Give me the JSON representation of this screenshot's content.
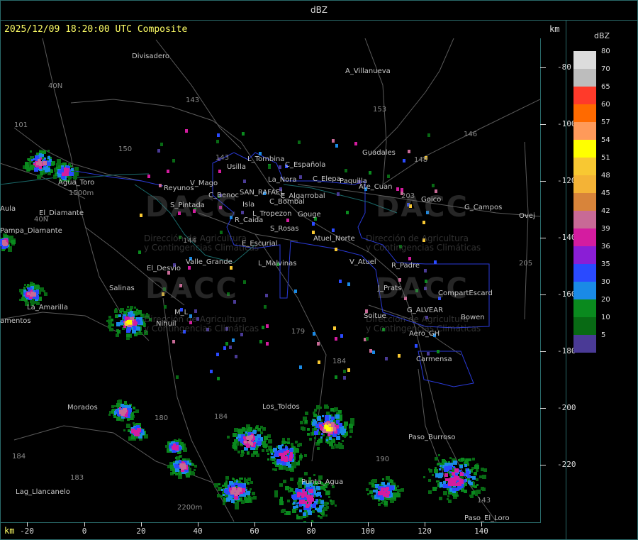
{
  "window_title": "dBZ",
  "header": {
    "datetime": "2025/12/09 18:20:00 UTC Composite",
    "km_top": "km",
    "km_bottom": "km"
  },
  "legend": {
    "title": "dBZ",
    "items": [
      {
        "label": "80",
        "color": "#dcdcdc"
      },
      {
        "label": "70",
        "color": "#bdbdbd"
      },
      {
        "label": "65",
        "color": "#ff3a2a"
      },
      {
        "label": "60",
        "color": "#ff6a00"
      },
      {
        "label": "57",
        "color": "#ff9a5a"
      },
      {
        "label": "54",
        "color": "#ffff00"
      },
      {
        "label": "51",
        "color": "#f8c832"
      },
      {
        "label": "48",
        "color": "#f4b336"
      },
      {
        "label": "45",
        "color": "#d8843a"
      },
      {
        "label": "42",
        "color": "#c86a96"
      },
      {
        "label": "39",
        "color": "#d41ca0"
      },
      {
        "label": "36",
        "color": "#8a1ed6"
      },
      {
        "label": "35",
        "color": "#2a4aff"
      },
      {
        "label": "30",
        "color": "#1a8ae6"
      },
      {
        "label": "20",
        "color": "#0a8a1e"
      },
      {
        "label": "10",
        "color": "#086a14"
      },
      {
        "label": "5",
        "color": "#4a3a96"
      }
    ]
  },
  "axes": {
    "y_ticks": [
      "-80",
      "-100",
      "-120",
      "-140",
      "-160",
      "-180",
      "-200",
      "-220"
    ],
    "x_ticks": [
      "-20",
      "0",
      "20",
      "40",
      "60",
      "80",
      "100",
      "120",
      "140"
    ]
  },
  "watermark": {
    "logo": "DACC",
    "line1": "Dirección de Agricultura",
    "line2": "y Contingencias Climáticas"
  },
  "places": [
    {
      "id": "divisadero",
      "text": "Divisadero"
    },
    {
      "id": "a-villanueva",
      "text": "A_Villanueva"
    },
    {
      "id": "guadales",
      "text": "Guadales"
    },
    {
      "id": "l-tombina",
      "text": "L_Tombina"
    },
    {
      "id": "usilla",
      "text": "Usilla"
    },
    {
      "id": "c-espanola",
      "text": "C_Española"
    },
    {
      "id": "la-nora",
      "text": "La_Nora"
    },
    {
      "id": "c-elepa",
      "text": "C_Elepa"
    },
    {
      "id": "paquilla",
      "text": "Paquilla"
    },
    {
      "id": "ate-cuan",
      "text": "Ate_Cuan"
    },
    {
      "id": "agua-toro",
      "text": "Agua_Toro"
    },
    {
      "id": "reyunos",
      "text": "Reyunos"
    },
    {
      "id": "v-mago",
      "text": "V_Mago"
    },
    {
      "id": "c-benoc",
      "text": "C_Benoc"
    },
    {
      "id": "san-rafael",
      "text": "SAN_RAFAEL"
    },
    {
      "id": "e-algarrobal",
      "text": "E_Algarrobal"
    },
    {
      "id": "c-bombal",
      "text": "C_Bombal"
    },
    {
      "id": "goico",
      "text": "Goico"
    },
    {
      "id": "g-campos",
      "text": "G_Campos"
    },
    {
      "id": "vuela",
      "text": "Aula"
    },
    {
      "id": "s-pintada",
      "text": "S_Pintada"
    },
    {
      "id": "isla",
      "text": "Isla"
    },
    {
      "id": "l-tropezon",
      "text": "L_Tropezon"
    },
    {
      "id": "gouge",
      "text": "Gouge"
    },
    {
      "id": "el-diamante",
      "text": "El_Diamante"
    },
    {
      "id": "r-caida",
      "text": "R_Caida"
    },
    {
      "id": "s-rosas",
      "text": "S_Rosas"
    },
    {
      "id": "ovejero",
      "text": "Ovej"
    },
    {
      "id": "pampa-diamante",
      "text": "Pampa_Diamante"
    },
    {
      "id": "e-escurial",
      "text": "E_Escurial"
    },
    {
      "id": "atuel-norte",
      "text": "Atuel_Norte"
    },
    {
      "id": "valle-grande",
      "text": "Valle_Grande"
    },
    {
      "id": "l-malvinas",
      "text": "L_Malvinas"
    },
    {
      "id": "v-atuel",
      "text": "V_Atuel"
    },
    {
      "id": "r-padre",
      "text": "R_Padre"
    },
    {
      "id": "el-desvio",
      "text": "El_Desvio"
    },
    {
      "id": "salinas",
      "text": "Salinas"
    },
    {
      "id": "j-prats",
      "text": "J_Prats"
    },
    {
      "id": "compart-escard",
      "text": "CompartEscard"
    },
    {
      "id": "la-amarilla",
      "text": "La_Amarilla"
    },
    {
      "id": "g-alvear",
      "text": "G_ALVEAR"
    },
    {
      "id": "m-l",
      "text": "M_L"
    },
    {
      "id": "soitue",
      "text": "Soitue"
    },
    {
      "id": "bowen",
      "text": "Bowen"
    },
    {
      "id": "sacramentos",
      "text": "amentos"
    },
    {
      "id": "nihuil",
      "text": "Nihuil"
    },
    {
      "id": "aero-gh",
      "text": "Aero_GH"
    },
    {
      "id": "carmensa",
      "text": "Carmensa"
    },
    {
      "id": "morados",
      "text": "Morados"
    },
    {
      "id": "los-toldos",
      "text": "Los_Toldos"
    },
    {
      "id": "paso-burroso",
      "text": "Paso_Burroso"
    },
    {
      "id": "punta-agua",
      "text": "Punta_Agua"
    },
    {
      "id": "lag-llancanelo",
      "text": "Lag_Llancanelo"
    },
    {
      "id": "paso-el-loro",
      "text": "Paso_El_Loro"
    }
  ],
  "highways": [
    {
      "id": "r40n",
      "text": "40N"
    },
    {
      "id": "r40n-b",
      "text": "40N"
    },
    {
      "id": "r143",
      "text": "143"
    },
    {
      "id": "r153",
      "text": "153"
    },
    {
      "id": "r146",
      "text": "146"
    },
    {
      "id": "r101",
      "text": "101"
    },
    {
      "id": "r150",
      "text": "150"
    },
    {
      "id": "r143b",
      "text": "143"
    },
    {
      "id": "r148",
      "text": "148"
    },
    {
      "id": "r203",
      "text": "203"
    },
    {
      "id": "r144",
      "text": "144"
    },
    {
      "id": "r205",
      "text": "205"
    },
    {
      "id": "r179",
      "text": "179"
    },
    {
      "id": "r184",
      "text": "184"
    },
    {
      "id": "r180",
      "text": "180"
    },
    {
      "id": "r184b",
      "text": "184"
    },
    {
      "id": "r184c",
      "text": "184"
    },
    {
      "id": "r183",
      "text": "183"
    },
    {
      "id": "r190",
      "text": "190"
    },
    {
      "id": "r143c",
      "text": "143"
    },
    {
      "id": "r1500",
      "text": "1500m"
    },
    {
      "id": "r2200",
      "text": "2200m"
    }
  ]
}
